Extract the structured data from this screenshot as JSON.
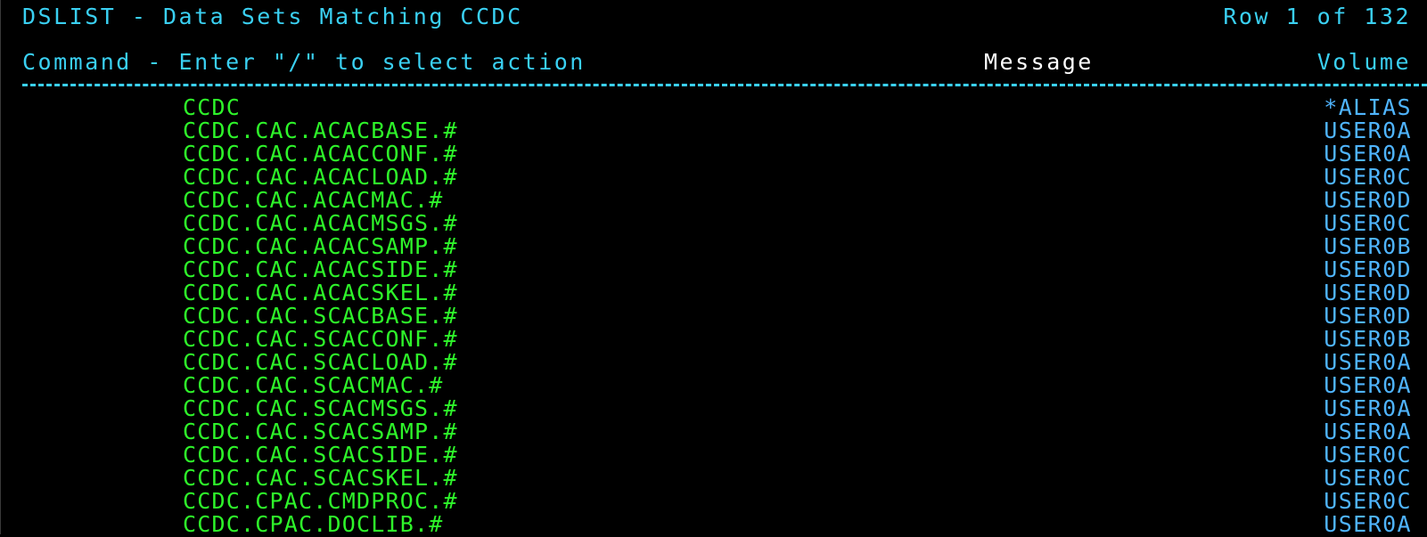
{
  "header": {
    "title": "DSLIST - Data Sets Matching CCDC",
    "row_info": "Row 1 of 132",
    "command_label": "Command - Enter \"/\" to select action",
    "message_label": "Message",
    "volume_label": "Volume"
  },
  "colors": {
    "background": "#000000",
    "header_text": "#3ad0f2",
    "dataset_name": "#2ef52a",
    "volume": "#4fb4ff",
    "message_label": "#ffffff"
  },
  "datasets": [
    {
      "name": "CCDC",
      "volume": "*ALIAS"
    },
    {
      "name": "CCDC.CAC.ACACBASE.#",
      "volume": "USER0A"
    },
    {
      "name": "CCDC.CAC.ACACCONF.#",
      "volume": "USER0A"
    },
    {
      "name": "CCDC.CAC.ACACLOAD.#",
      "volume": "USER0C"
    },
    {
      "name": "CCDC.CAC.ACACMAC.#",
      "volume": "USER0D"
    },
    {
      "name": "CCDC.CAC.ACACMSGS.#",
      "volume": "USER0C"
    },
    {
      "name": "CCDC.CAC.ACACSAMP.#",
      "volume": "USER0B"
    },
    {
      "name": "CCDC.CAC.ACACSIDE.#",
      "volume": "USER0D"
    },
    {
      "name": "CCDC.CAC.ACACSKEL.#",
      "volume": "USER0D"
    },
    {
      "name": "CCDC.CAC.SCACBASE.#",
      "volume": "USER0D"
    },
    {
      "name": "CCDC.CAC.SCACCONF.#",
      "volume": "USER0B"
    },
    {
      "name": "CCDC.CAC.SCACLOAD.#",
      "volume": "USER0A"
    },
    {
      "name": "CCDC.CAC.SCACMAC.#",
      "volume": "USER0A"
    },
    {
      "name": "CCDC.CAC.SCACMSGS.#",
      "volume": "USER0A"
    },
    {
      "name": "CCDC.CAC.SCACSAMP.#",
      "volume": "USER0A"
    },
    {
      "name": "CCDC.CAC.SCACSIDE.#",
      "volume": "USER0C"
    },
    {
      "name": "CCDC.CAC.SCACSKEL.#",
      "volume": "USER0C"
    },
    {
      "name": "CCDC.CPAC.CMDPROC.#",
      "volume": "USER0C"
    },
    {
      "name": "CCDC.CPAC.DOCLIB.#",
      "volume": "USER0A"
    }
  ]
}
